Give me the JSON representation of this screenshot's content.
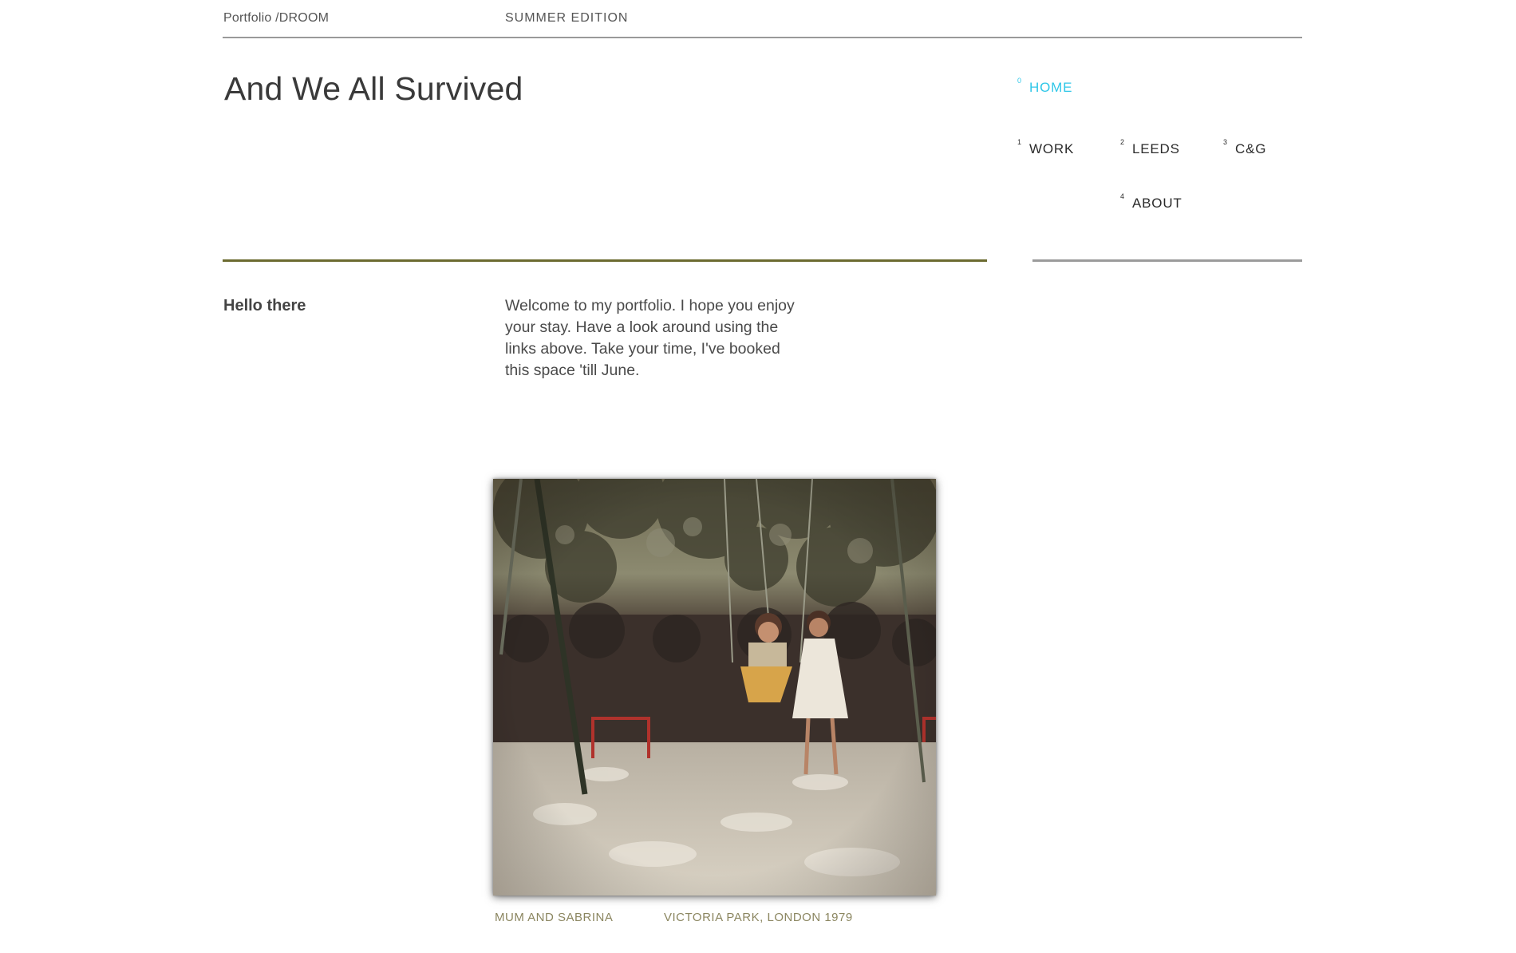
{
  "header": {
    "brand": "Portfolio /DROOM",
    "edition": "SUMMER EDITION"
  },
  "page": {
    "title": "And We All Survived"
  },
  "nav": {
    "items": [
      {
        "num": "0",
        "label": "HOME",
        "active": true
      },
      {
        "num": "1",
        "label": "WORK",
        "active": false
      },
      {
        "num": "2",
        "label": "LEEDS",
        "active": false
      },
      {
        "num": "3",
        "label": "C&G",
        "active": false
      },
      {
        "num": "4",
        "label": "ABOUT",
        "active": false
      }
    ]
  },
  "intro": {
    "heading": "Hello there",
    "text": "Welcome to my portfolio. I hope you enjoy your stay. Have a look around using the links above. Take your time, I've booked this space 'till June."
  },
  "photo": {
    "caption_subject": "MUM AND SABRINA",
    "caption_place": "VICTORIA PARK, LONDON 1979"
  },
  "colors": {
    "nav_active": "#2fc7e8",
    "rule_olive": "#6b6a2f",
    "caption": "#8b8660"
  }
}
